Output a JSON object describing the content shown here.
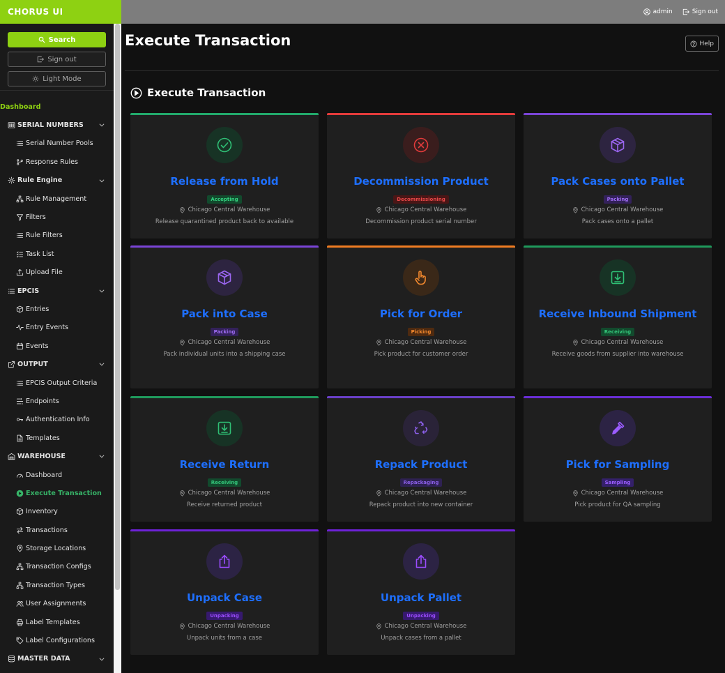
{
  "app": {
    "brand": "CHORUS UI",
    "user": "admin",
    "signout": "Sign out"
  },
  "sidebar": {
    "search": "Search",
    "signout": "Sign out",
    "lightmode": "Light Mode",
    "nav": [
      {
        "label": "Dashboard",
        "kind": "green"
      },
      {
        "label": "SERIAL NUMBERS",
        "kind": "top",
        "icon": "barcode-icon",
        "chev": true
      },
      {
        "label": "Serial Number Pools",
        "kind": "sub",
        "icon": "list-icon"
      },
      {
        "label": "Response Rules",
        "kind": "sub",
        "icon": "branch-icon"
      },
      {
        "label": "Rule Engine",
        "kind": "top",
        "icon": "gear-icon",
        "chev": true
      },
      {
        "label": "Rule Management",
        "kind": "sub",
        "icon": "hierarchy-icon"
      },
      {
        "label": "Filters",
        "kind": "sub",
        "icon": "filter-icon"
      },
      {
        "label": "Rule Filters",
        "kind": "sub",
        "icon": "list-icon"
      },
      {
        "label": "Task List",
        "kind": "sub",
        "icon": "tasklist-icon"
      },
      {
        "label": "Upload File",
        "kind": "sub",
        "icon": "upload-icon"
      },
      {
        "label": "EPCIS",
        "kind": "top",
        "icon": "list-icon",
        "chev": true
      },
      {
        "label": "Entries",
        "kind": "sub",
        "icon": "box-icon"
      },
      {
        "label": "Entry Events",
        "kind": "sub",
        "icon": "pulse-icon"
      },
      {
        "label": "Events",
        "kind": "sub",
        "icon": "calendar-icon"
      },
      {
        "label": "OUTPUT",
        "kind": "top",
        "icon": "external-icon",
        "chev": true
      },
      {
        "label": "EPCIS Output Criteria",
        "kind": "sub",
        "icon": "list-icon"
      },
      {
        "label": "Endpoints",
        "kind": "sub",
        "icon": "endpoint-icon"
      },
      {
        "label": "Authentication Info",
        "kind": "sub",
        "icon": "key-icon"
      },
      {
        "label": "Templates",
        "kind": "sub",
        "icon": "document-icon"
      },
      {
        "label": "WAREHOUSE",
        "kind": "top",
        "icon": "warehouse-icon",
        "chev": true
      },
      {
        "label": "Dashboard",
        "kind": "sub",
        "icon": "gauge-icon"
      },
      {
        "label": "Execute Transaction",
        "kind": "sub active",
        "icon": "play-circle-icon"
      },
      {
        "label": "Inventory",
        "kind": "sub",
        "icon": "box-icon"
      },
      {
        "label": "Transactions",
        "kind": "sub",
        "icon": "swap-icon"
      },
      {
        "label": "Storage Locations",
        "kind": "sub",
        "icon": "pin-icon"
      },
      {
        "label": "Transaction Configs",
        "kind": "sub",
        "icon": "hierarchy-icon"
      },
      {
        "label": "Transaction Types",
        "kind": "sub",
        "icon": "hierarchy-icon"
      },
      {
        "label": "User Assignments",
        "kind": "sub",
        "icon": "users-icon"
      },
      {
        "label": "Label Templates",
        "kind": "sub",
        "icon": "printer-icon"
      },
      {
        "label": "Label Configurations",
        "kind": "sub",
        "icon": "tag-icon"
      },
      {
        "label": "MASTER DATA",
        "kind": "top",
        "icon": "database-icon",
        "chev": true
      }
    ]
  },
  "main": {
    "title": "Execute Transaction",
    "help": "Help",
    "section_title": "Execute Transaction",
    "cards": [
      {
        "title": "Release from Hold",
        "badge": "Accepting",
        "location": "Chicago Central Warehouse",
        "description": "Release quarantined product back to available",
        "icon": "check-circle-icon",
        "accent": "#22a96b",
        "badge_bg": "#124a2d",
        "badge_fg": "#34d17f",
        "circle_bg": "#173325",
        "icon_color": "#2fbf75"
      },
      {
        "title": "Decommission Product",
        "badge": "Decommissioning",
        "location": "Chicago Central Warehouse",
        "description": "Decommission product serial number",
        "icon": "x-circle-icon",
        "accent": "#e23b3b",
        "badge_bg": "#4a1616",
        "badge_fg": "#e84848",
        "circle_bg": "#3a1d1d",
        "icon_color": "#e23b3b"
      },
      {
        "title": "Pack Cases onto Pallet",
        "badge": "Packing",
        "location": "Chicago Central Warehouse",
        "description": "Pack cases onto a pallet",
        "icon": "box-icon",
        "accent": "#7a44d6",
        "badge_bg": "#33215a",
        "badge_fg": "#9e6cf2",
        "circle_bg": "#2d2440",
        "icon_color": "#9b66f0"
      },
      {
        "title": "Pack into Case",
        "badge": "Packing",
        "location": "Chicago Central Warehouse",
        "description": "Pack individual units into a shipping case",
        "icon": "box-icon",
        "accent": "#7a44d6",
        "badge_bg": "#33215a",
        "badge_fg": "#9e6cf2",
        "circle_bg": "#2d2440",
        "icon_color": "#9b66f0"
      },
      {
        "title": "Pick for Order",
        "badge": "Picking",
        "location": "Chicago Central Warehouse",
        "description": "Pick product for customer order",
        "icon": "hand-pointer-icon",
        "accent": "#f07c22",
        "badge_bg": "#4e2a10",
        "badge_fg": "#f58a2e",
        "circle_bg": "#3a2818",
        "icon_color": "#f58a2e"
      },
      {
        "title": "Receive Inbound Shipment",
        "badge": "Receiving",
        "location": "Chicago Central Warehouse",
        "description": "Receive goods from supplier into warehouse",
        "icon": "download-box-icon",
        "accent": "#1f9a5c",
        "badge_bg": "#124a2d",
        "badge_fg": "#34c57a",
        "circle_bg": "#173325",
        "icon_color": "#2fbf75"
      },
      {
        "title": "Receive Return",
        "badge": "Receiving",
        "location": "Chicago Central Warehouse",
        "description": "Receive returned product",
        "icon": "download-box-icon",
        "accent": "#1f9a5c",
        "badge_bg": "#124a2d",
        "badge_fg": "#34c57a",
        "circle_bg": "#173325",
        "icon_color": "#2fbf75"
      },
      {
        "title": "Repack Product",
        "badge": "Repackaging",
        "location": "Chicago Central Warehouse",
        "description": "Repack product into new container",
        "icon": "recycle-icon",
        "accent": "#6a3fc8",
        "badge_bg": "#2e2152",
        "badge_fg": "#8b5fe8",
        "circle_bg": "#2a2338",
        "icon_color": "#8b5fe8"
      },
      {
        "title": "Pick for Sampling",
        "badge": "Sampling",
        "location": "Chicago Central Warehouse",
        "description": "Pick product for QA sampling",
        "icon": "dropper-icon",
        "accent": "#6a2ed6",
        "badge_bg": "#34206a",
        "badge_fg": "#9a5cff",
        "circle_bg": "#2c2344",
        "icon_color": "#9a5cff"
      },
      {
        "title": "Unpack Case",
        "badge": "Unpacking",
        "location": "Chicago Central Warehouse",
        "description": "Unpack units from a case",
        "icon": "upload-box-icon",
        "accent": "#6e22d8",
        "badge_bg": "#36196e",
        "badge_fg": "#9b4cff",
        "circle_bg": "#2c2344",
        "icon_color": "#9b4cff"
      },
      {
        "title": "Unpack Pallet",
        "badge": "Unpacking",
        "location": "Chicago Central Warehouse",
        "description": "Unpack cases from a pallet",
        "icon": "upload-box-icon",
        "accent": "#6e22d8",
        "badge_bg": "#36196e",
        "badge_fg": "#9b4cff",
        "circle_bg": "#2c2344",
        "icon_color": "#9b4cff"
      }
    ]
  }
}
